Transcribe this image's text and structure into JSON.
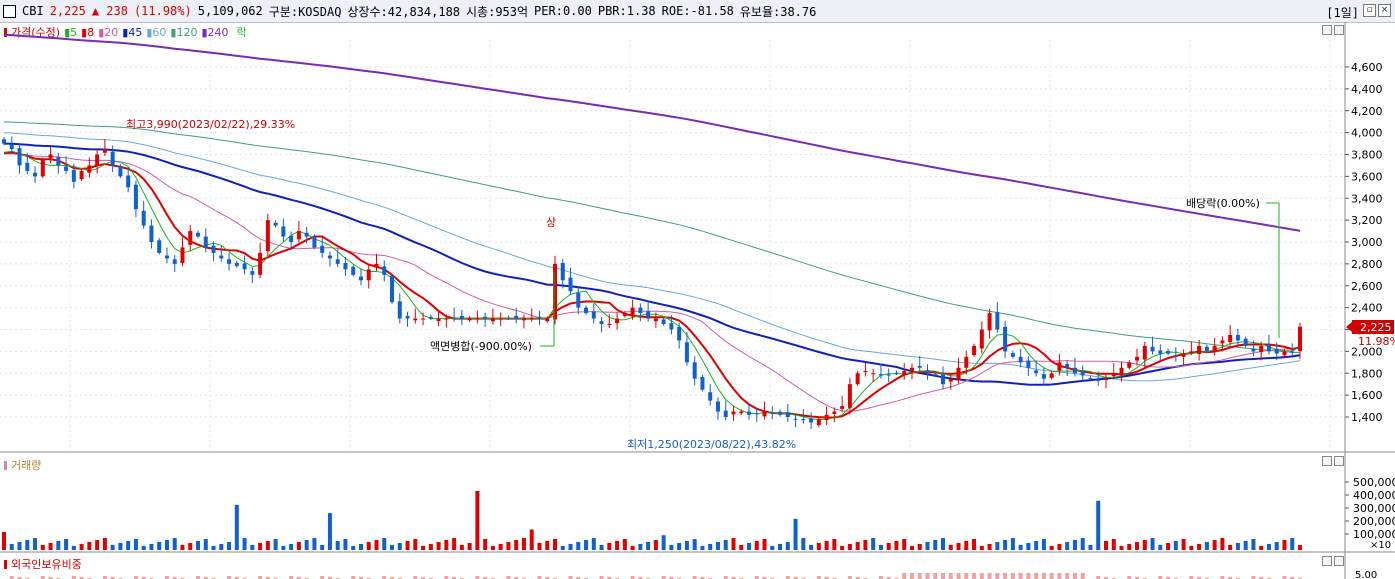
{
  "header": {
    "symbol": "CBI",
    "price": "2,225",
    "change": "▲ 238",
    "change_pct": "(11.98%)",
    "volume": "5,109,062",
    "market": "구분:KOSDAQ",
    "shares": "상장수:42,834,188",
    "mcap": "시총:953억",
    "per": "PER:0.00",
    "pbr": "PBR:1.38",
    "roe": "ROE:-81.58",
    "float": "유보율:38.76",
    "period": "[1일]"
  },
  "legend": {
    "price_label": "가격(수정)",
    "ma": [
      {
        "label": "5",
        "color": "#1bb51b"
      },
      {
        "label": "8",
        "color": "#e00000"
      },
      {
        "label": "20",
        "color": "#d45aa8"
      },
      {
        "label": "45",
        "color": "#1020c0"
      },
      {
        "label": "60",
        "color": "#6aa8d8"
      },
      {
        "label": "120",
        "color": "#3fa07a"
      },
      {
        "label": "240",
        "color": "#7a2ab8"
      }
    ],
    "drop_label": "락"
  },
  "price_axis": [
    "4,600",
    "4,400",
    "4,200",
    "4,000",
    "3,800",
    "3,600",
    "3,400",
    "3,200",
    "3,000",
    "2,800",
    "2,600",
    "2,400",
    "2,200",
    "2,000",
    "1,800",
    "1,600",
    "1,400"
  ],
  "current_price_tag": "2,225",
  "current_pct_tag": "11.98%",
  "annotations": {
    "high": "최고3,990(2023/02/22),29.33%",
    "low": "최저1,250(2023/08/22),43.82%",
    "reverse_split": "액면병합(-900.00%)",
    "dividend": "배당락(0.00%)",
    "limit_up": "상"
  },
  "volume_pane": {
    "label": "거래량",
    "axis": [
      "500,000",
      "400,000",
      "300,000",
      "200,000",
      "100,000"
    ],
    "unit": "×10"
  },
  "foreign_pane": {
    "label": "외국인보유비중",
    "axis": [
      "5.00"
    ]
  },
  "colors": {
    "up": "#e00000",
    "down": "#1060d0",
    "ma240": "#7a2ab8",
    "ma45": "#1020c0"
  },
  "chart_data": {
    "type": "candlestick",
    "closes": [
      3900,
      3850,
      3700,
      3650,
      3600,
      3750,
      3800,
      3700,
      3650,
      3550,
      3650,
      3700,
      3800,
      3850,
      3700,
      3600,
      3500,
      3300,
      3150,
      3000,
      2900,
      2850,
      2800,
      2950,
      3100,
      3050,
      2950,
      2900,
      2850,
      2800,
      2780,
      2750,
      2700,
      2900,
      3200,
      3150,
      3050,
      3000,
      3100,
      3050,
      2950,
      2900,
      2850,
      2800,
      2750,
      2700,
      2650,
      2750,
      2800,
      2700,
      2450,
      2300,
      2300,
      2300,
      2300,
      2300,
      2300,
      2300,
      2300,
      2300,
      2300,
      2300,
      2300,
      2300,
      2300,
      2300,
      2300,
      2300,
      2300,
      2300,
      2300,
      2800,
      2650,
      2550,
      2400,
      2350,
      2300,
      2250,
      2250,
      2300,
      2350,
      2400,
      2350,
      2300,
      2300,
      2250,
      2200,
      2100,
      1900,
      1750,
      1650,
      1550,
      1450,
      1400,
      1450,
      1450,
      1420,
      1430,
      1450,
      1440,
      1420,
      1400,
      1380,
      1370,
      1350,
      1380,
      1420,
      1450,
      1500,
      1700,
      1800,
      1820,
      1800,
      1780,
      1780,
      1800,
      1820,
      1850,
      1850,
      1800,
      1780,
      1700,
      1750,
      1850,
      1950,
      2050,
      2200,
      2350,
      2200,
      2000,
      1950,
      1900,
      1850,
      1800,
      1750,
      1800,
      1900,
      1850,
      1800,
      1780,
      1750,
      1730,
      1750,
      1800,
      1850,
      1900,
      1950,
      2050,
      2000,
      1980,
      1980,
      1950,
      1980,
      2000,
      2050,
      2000,
      2050,
      2100,
      2150,
      2100,
      2050,
      2000,
      2050,
      2000,
      1980,
      2000,
      1987,
      2225
    ]
  }
}
